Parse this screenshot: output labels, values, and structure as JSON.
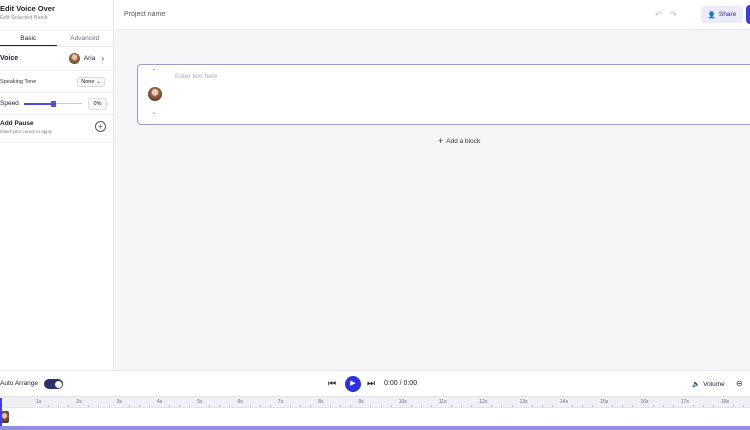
{
  "panel": {
    "title": "Edit Voice Over",
    "subtitle": "Edit Selected Block",
    "tabs": [
      "Basic",
      "Advanced"
    ],
    "voice_label": "Voice",
    "voice_name": "Aria",
    "tone_label": "Speaking Tone",
    "tone_value": "None",
    "speed_label": "Speed",
    "speed_value": "0%",
    "speed_level": 0.5,
    "pause_label": "Add Pause",
    "pause_sub": "Insert your cursor to apply"
  },
  "topbar": {
    "project_name": "Project name",
    "share_label": "Share"
  },
  "editor": {
    "placeholder": "Enter text here",
    "add_block_label": "Add a block"
  },
  "player": {
    "auto_arrange_label": "Auto Arrange",
    "auto_arrange_on": true,
    "time": "0:00 / 0:00",
    "volume_label": "Volume"
  },
  "timeline": {
    "ticks": [
      "1s",
      "2s",
      "3s",
      "4s",
      "5s",
      "6s",
      "7s",
      "8s",
      "9s",
      "10s",
      "11s",
      "12s",
      "13s",
      "14s",
      "15s",
      "16s",
      "17s",
      "18s"
    ]
  },
  "colors": {
    "accent": "#2d31e0",
    "toggle": "#2b2f6b",
    "block_border": "#9c9cc8"
  }
}
